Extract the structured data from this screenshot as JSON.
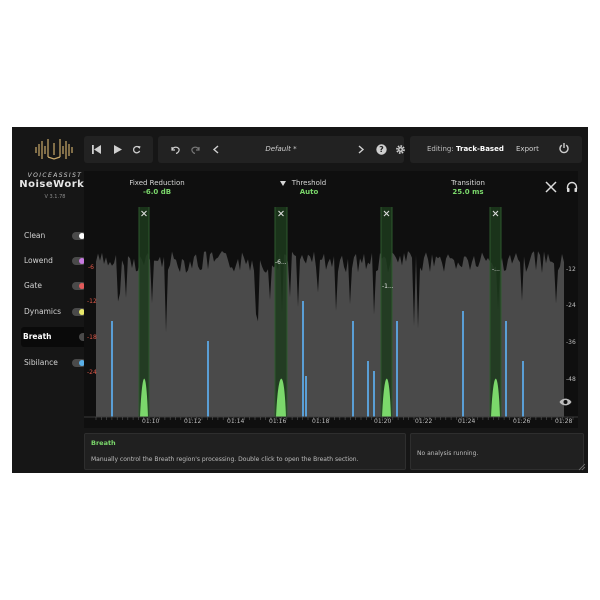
{
  "brand": {
    "top": "VOICEASSIST",
    "name": "NoiseWorks",
    "version": "V 3.1.78"
  },
  "sidebar": {
    "items": [
      {
        "label": "Clean",
        "knob_color": "#ffffff",
        "active": false
      },
      {
        "label": "Lowend",
        "knob_color": "#c77ae0",
        "active": false
      },
      {
        "label": "Gate",
        "knob_color": "#e05a5a",
        "active": false
      },
      {
        "label": "Dynamics",
        "knob_color": "#e8e86a",
        "active": false
      },
      {
        "label": "Breath",
        "knob_color": "#7bd86b",
        "active": true
      },
      {
        "label": "Sibilance",
        "knob_color": "#5ab0e8",
        "active": false
      }
    ]
  },
  "toolbar": {
    "transport_icons": [
      "skip-back-icon",
      "play-icon",
      "loop-icon"
    ],
    "preset_icons": [
      "undo-icon",
      "redo-icon",
      "chevron-left-icon",
      "chevron-right-icon",
      "help-icon",
      "settings-icon"
    ],
    "preset_name": "Default *",
    "editing_label": "Editing:",
    "editing_mode": "Track-Based",
    "export_label": "Export"
  },
  "editor": {
    "fixed_reduction": {
      "label": "Fixed Reduction",
      "value": "-6.0 dB"
    },
    "threshold": {
      "label": "Threshold",
      "value": "Auto"
    },
    "transition": {
      "label": "Transition",
      "value": "25.0 ms"
    },
    "left_scale": [
      "-6",
      "-12",
      "-18",
      "-24"
    ],
    "right_scale": [
      "-12",
      "-24",
      "-36",
      "-48"
    ],
    "timeline": [
      "01:10",
      "01:12",
      "01:14",
      "01:16",
      "01:18",
      "01:20",
      "01:22",
      "01:24",
      "01:26",
      "01:28"
    ],
    "region_labels": [
      "-6...",
      "-1...",
      "-..."
    ],
    "accent": "#7bd86b",
    "spike_color": "#5a9fd6"
  },
  "info": {
    "title": "Breath",
    "text": "Manually control the Breath region's processing. Double click to open the Breath section."
  },
  "status": {
    "text": "No analysis running."
  }
}
